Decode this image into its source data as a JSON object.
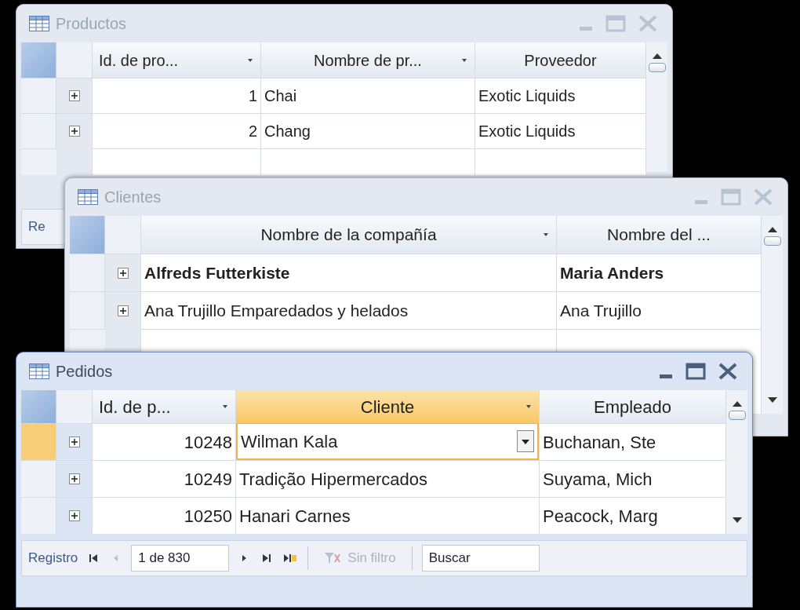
{
  "windows": [
    {
      "title": "Productos",
      "active": false,
      "columns": [
        {
          "label": "Id. de pro...",
          "kind": "number",
          "dropdown": true,
          "selected": false
        },
        {
          "label": "Nombre de pr...",
          "kind": "text",
          "dropdown": true,
          "selected": false
        },
        {
          "label": "Proveedor",
          "kind": "text",
          "dropdown": false,
          "selected": false
        }
      ],
      "rows": [
        {
          "cells": [
            "1",
            "Chai",
            "Exotic Liquids"
          ],
          "selected": false,
          "bold": false
        },
        {
          "cells": [
            "2",
            "Chang",
            "Exotic Liquids"
          ],
          "selected": false,
          "bold": false
        }
      ],
      "navigation": {
        "label": "Re"
      }
    },
    {
      "title": "Clientes",
      "active": false,
      "columns": [
        {
          "label": "Nombre de la compañía",
          "kind": "text",
          "dropdown": true,
          "selected": false
        },
        {
          "label": "Nombre del ...",
          "kind": "text",
          "dropdown": false,
          "selected": false
        }
      ],
      "rows": [
        {
          "cells": [
            "Alfreds Futterkiste",
            "Maria Anders"
          ],
          "selected": false,
          "bold": true
        },
        {
          "cells": [
            "Ana Trujillo Emparedados y helados",
            "Ana Trujillo"
          ],
          "selected": false,
          "bold": false
        }
      ]
    },
    {
      "title": "Pedidos",
      "active": true,
      "columns": [
        {
          "label": "Id. de p...",
          "kind": "number",
          "dropdown": true,
          "selected": false
        },
        {
          "label": "Cliente",
          "kind": "text",
          "dropdown": true,
          "selected": true
        },
        {
          "label": "Empleado",
          "kind": "text",
          "dropdown": false,
          "selected": false
        }
      ],
      "rows": [
        {
          "cells": [
            "10248",
            "Wilman Kala",
            "Buchanan, Ste"
          ],
          "selected": true,
          "bold": false
        },
        {
          "cells": [
            "10249",
            "Tradição Hipermercados",
            "Suyama, Mich"
          ],
          "selected": false,
          "bold": false
        },
        {
          "cells": [
            "10250",
            "Hanari Carnes",
            "Peacock, Marg"
          ],
          "selected": false,
          "bold": false
        }
      ],
      "navigation": {
        "label": "Registro",
        "position": "1 de 830",
        "filter": "Sin filtro",
        "filter_active": false,
        "search_placeholder": "Buscar"
      }
    }
  ]
}
